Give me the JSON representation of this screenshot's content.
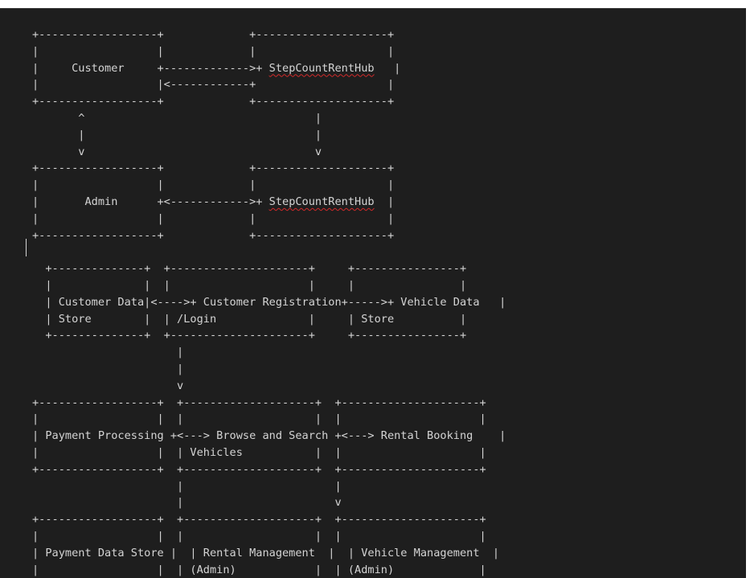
{
  "diagram": {
    "lines": [
      "+------------------+             +--------------------+",
      "|                  |             |                    |",
      "|     Customer     +------------->+ StepCountRentHub   |",
      "|                  |<------------+                    |",
      "+------------------+             +--------------------+",
      "       ^                                   |",
      "       |                                   |",
      "       v                                   v",
      "+------------------+             +--------------------+",
      "|                  |             |                    |",
      "|       Admin      +<------------>+ StepCountRentHub  |",
      "|                  |             |                    |",
      "+------------------+             +--------------------+",
      "",
      "  +--------------+  +---------------------+     +----------------+",
      "  |              |  |                     |     |                |",
      "  | Customer Data|<---->+ Customer Registration+----->+ Vehicle Data   |",
      "  | Store        |  | /Login              |     | Store          |",
      "  +--------------+  +---------------------+     +----------------+",
      "                      |",
      "                      |",
      "                      v",
      "+------------------+  +--------------------+  +---------------------+",
      "|                  |  |                    |  |                     |",
      "| Payment Processing +<---> Browse and Search +<---> Rental Booking    |",
      "|                  |  | Vehicles           |  |                     |",
      "+------------------+  +--------------------+  +---------------------+",
      "                      |                       |",
      "                      |                       v",
      "+------------------+  +--------------------+  +---------------------+",
      "|                  |  |                    |  |                     |",
      "| Payment Data Store |  | Rental Management  |  | Vehicle Management  |",
      "|                  |  | (Admin)            |  | (Admin)             |",
      "+------------------+  +--------------------+  +---------------------+"
    ],
    "misspelled_word": "StepCountRentHub"
  }
}
